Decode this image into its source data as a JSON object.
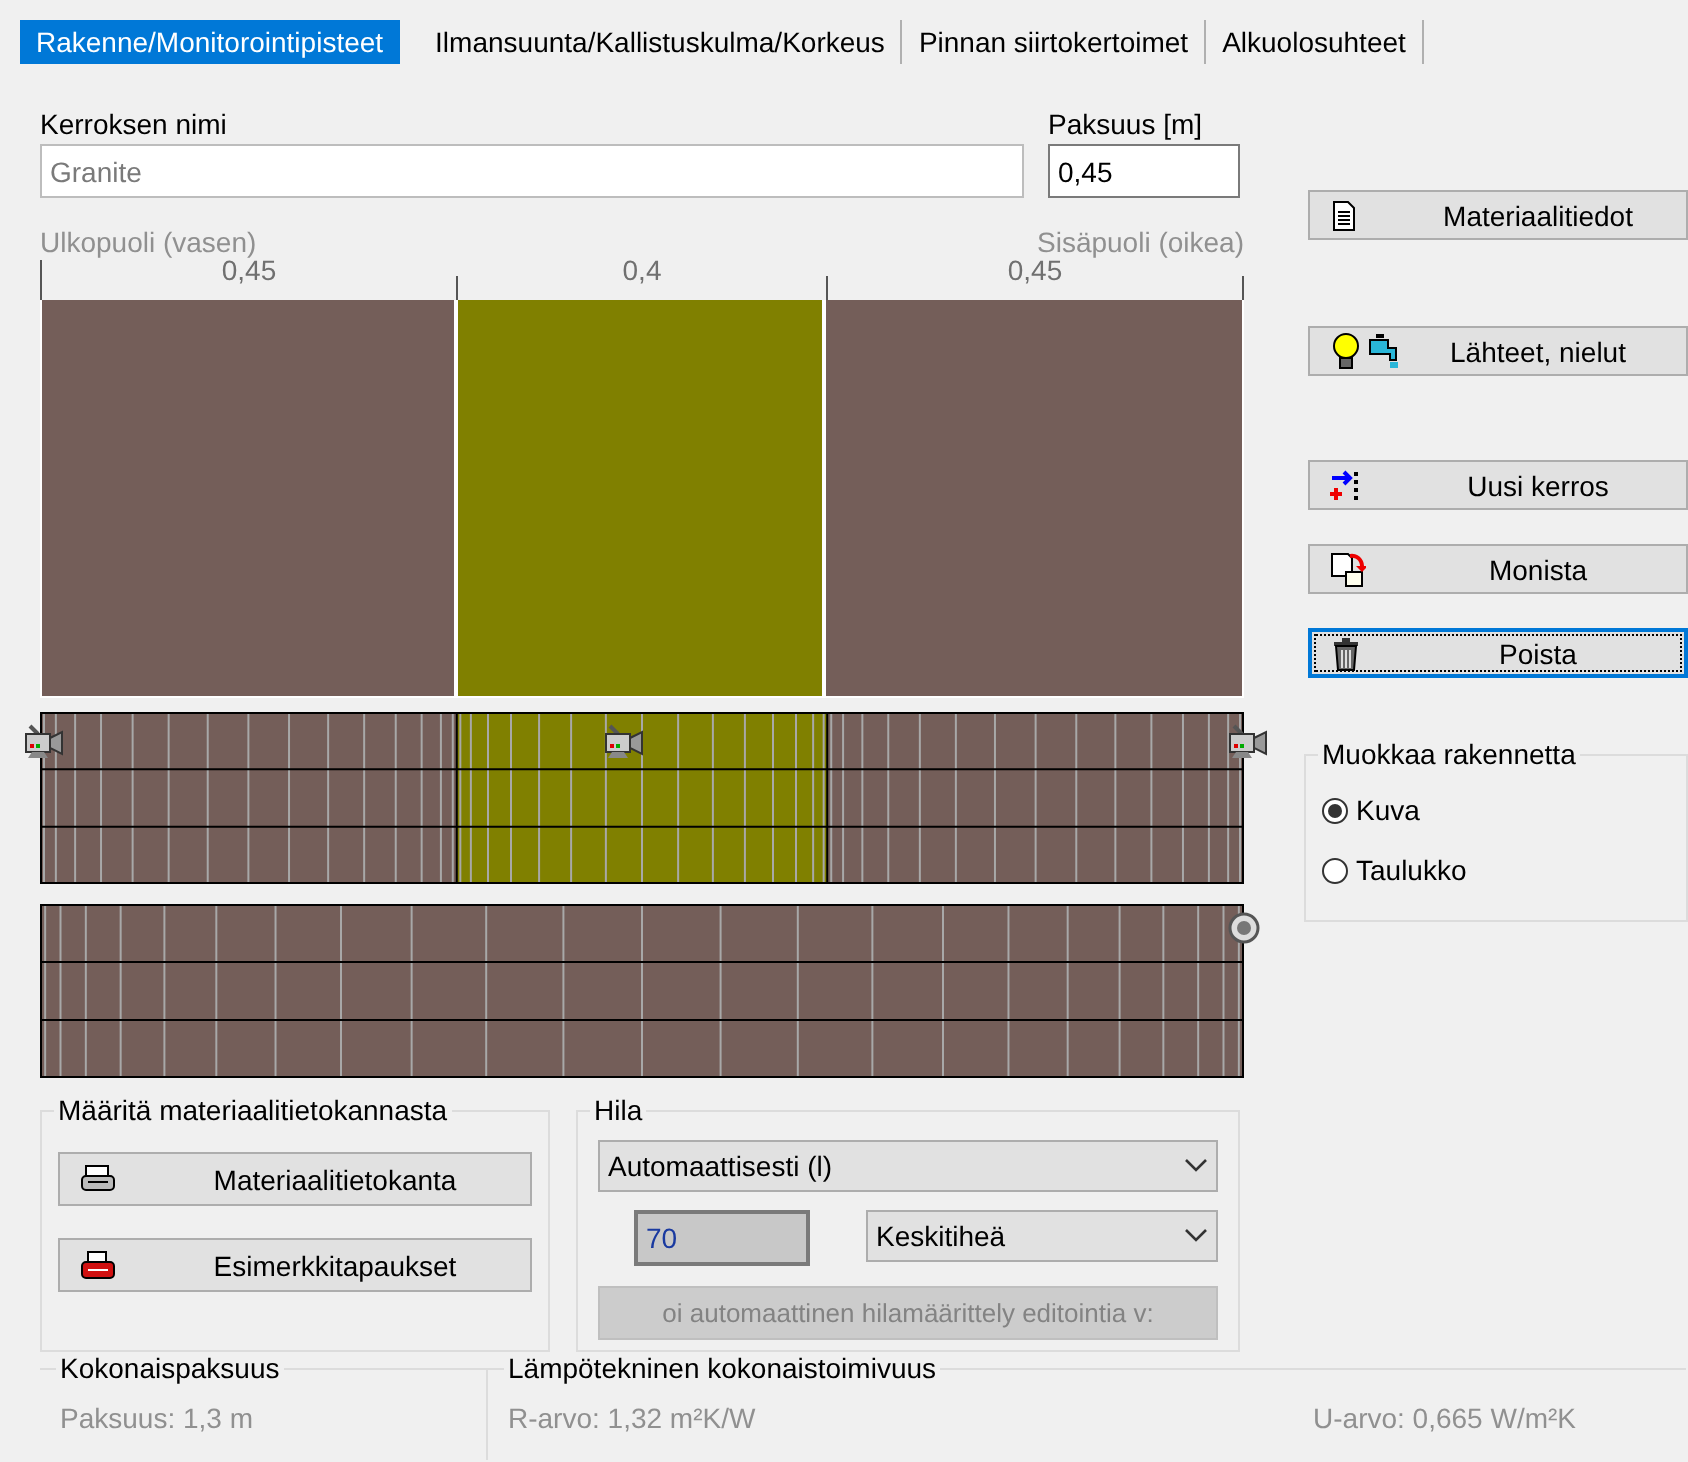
{
  "tabs": [
    {
      "label": "Rakenne/Monitorointipisteet",
      "selected": true
    },
    {
      "label": "Ilmansuunta/Kallistuskulma/Korkeus",
      "selected": false
    },
    {
      "label": "Pinnan siirtokertoimet",
      "selected": false
    },
    {
      "label": "Alkuolosuhteet",
      "selected": false
    }
  ],
  "layer_name": {
    "label": "Kerroksen nimi",
    "value": "Granite"
  },
  "thickness": {
    "label": "Paksuus [m]",
    "value": "0,45"
  },
  "side_labels": {
    "outside": "Ulkopuoli (vasen)",
    "inside": "Sisäpuoli (oikea)"
  },
  "layers": [
    {
      "thickness": "0,45",
      "color": "#745e59"
    },
    {
      "thickness": "0,4",
      "color": "#808000"
    },
    {
      "thickness": "0,45",
      "color": "#745e59"
    }
  ],
  "actions": [
    {
      "label": "Materiaalitiedot",
      "focused": false
    },
    {
      "label": "Lähteet, nielut",
      "focused": false
    },
    {
      "label": "Uusi kerros",
      "focused": false
    },
    {
      "label": "Monista",
      "focused": false
    },
    {
      "label": "Poista",
      "focused": true
    }
  ],
  "edit_mode": {
    "title": "Muokkaa rakennetta",
    "options": [
      {
        "label": "Kuva",
        "selected": true
      },
      {
        "label": "Taulukko",
        "selected": false
      }
    ]
  },
  "database": {
    "title": "Määritä materiaalitietokannasta",
    "buttons": [
      "Materiaalitietokanta",
      "Esimerkkitapaukset"
    ]
  },
  "mesh": {
    "title": "Hila",
    "mode": "Automaattisesti (l)",
    "count": "70",
    "density": "Keskitiheä",
    "edit_button": {
      "label": "oi automaattinen hilamäärittely editointia v:",
      "disabled": true
    }
  },
  "total_thickness": {
    "title": "Kokonaispaksuus",
    "value": "Paksuus: 1,3 m"
  },
  "performance": {
    "title": "Lämpötekninen kokonaistoimivuus",
    "r_value": "R-arvo: 1,32 m²K/W",
    "u_value": "U-arvo: 0,665 W/m²K"
  }
}
